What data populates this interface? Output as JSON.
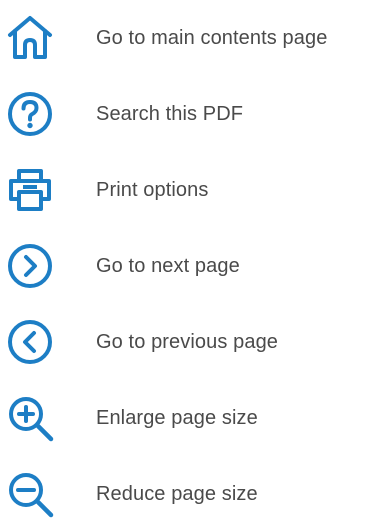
{
  "theme": {
    "icon_color": "#1d7ec5",
    "text_color": "#4a4a4a"
  },
  "legend": {
    "items": [
      {
        "icon": "home-icon",
        "label": "Go to main contents page"
      },
      {
        "icon": "help-icon",
        "label": "Search this PDF"
      },
      {
        "icon": "printer-icon",
        "label": "Print options"
      },
      {
        "icon": "chevron-right-circle-icon",
        "label": "Go to next page"
      },
      {
        "icon": "chevron-left-circle-icon",
        "label": "Go to previous page"
      },
      {
        "icon": "zoom-in-icon",
        "label": "Enlarge page size"
      },
      {
        "icon": "zoom-out-icon",
        "label": "Reduce page size"
      }
    ]
  }
}
